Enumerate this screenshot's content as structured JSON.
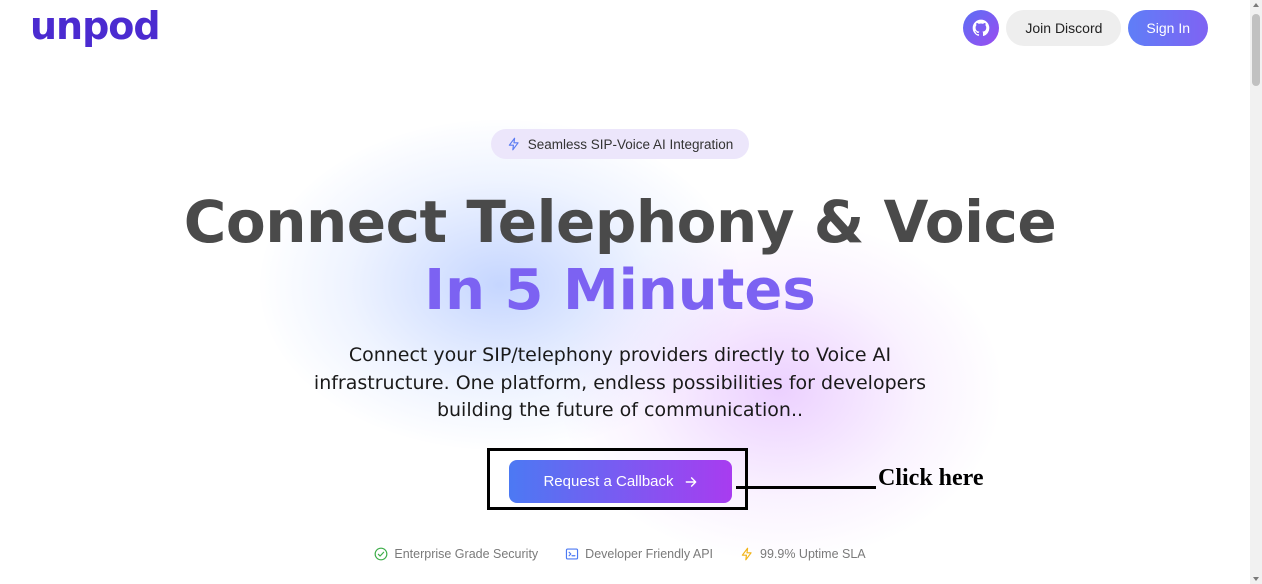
{
  "brand": {
    "logo_text": "unpod"
  },
  "nav": {
    "github_icon": "github-icon",
    "discord_label": "Join Discord",
    "signin_label": "Sign In"
  },
  "hero": {
    "badge_icon": "lightning-icon",
    "badge_label": "Seamless SIP-Voice AI Integration",
    "title_line1": "Connect Telephony & Voice",
    "title_line2": "In 5 Minutes",
    "description_line1": "Connect your SIP/telephony providers directly to Voice AI",
    "description_line2": "infrastructure. One platform, endless possibilities for developers",
    "description_line3": "building the future of communication..",
    "cta_label": "Request a Callback",
    "cta_icon": "arrow-right-icon"
  },
  "annotation": {
    "label": "Click here"
  },
  "features": [
    {
      "icon": "check-circle-icon",
      "label": "Enterprise Grade Security"
    },
    {
      "icon": "terminal-icon",
      "label": "Developer Friendly API"
    },
    {
      "icon": "lightning-icon",
      "label": "99.9% Uptime SLA"
    }
  ],
  "colors": {
    "brand": "#4b2bd0",
    "accent": "#7c62f2",
    "cta_start": "#4c79f3",
    "cta_end": "#a83cf0"
  }
}
